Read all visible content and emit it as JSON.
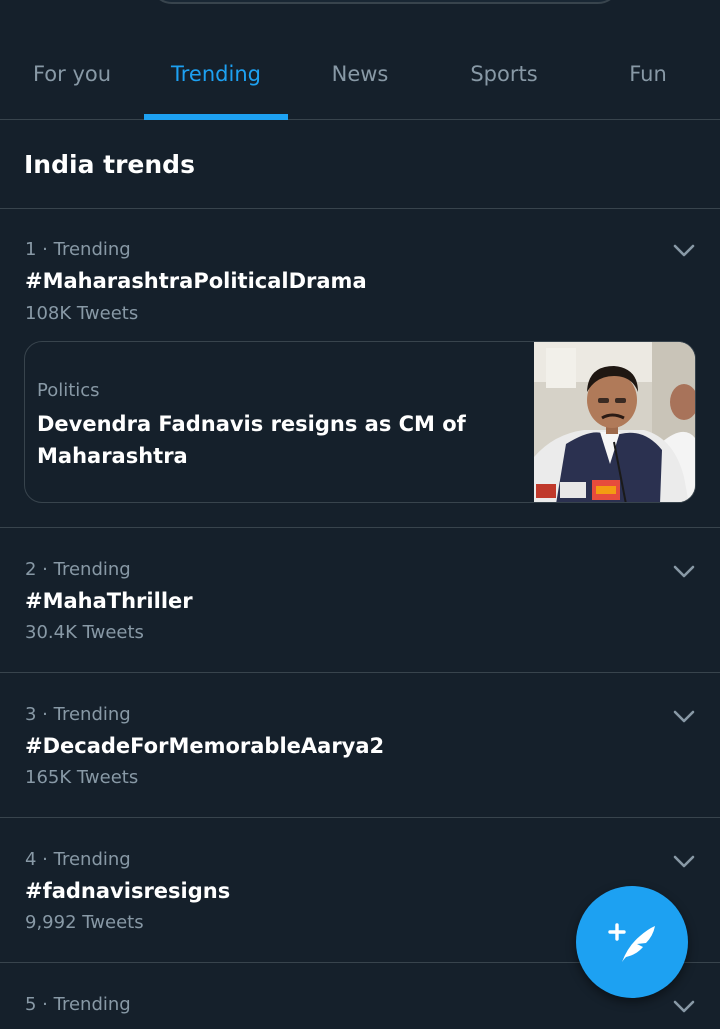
{
  "tabs": [
    {
      "label": "For you",
      "active": false
    },
    {
      "label": "Trending",
      "active": true
    },
    {
      "label": "News",
      "active": false
    },
    {
      "label": "Sports",
      "active": false
    },
    {
      "label": "Fun",
      "active": false
    }
  ],
  "section": {
    "title": "India trends"
  },
  "trends": [
    {
      "meta": "1 · Trending",
      "name": "#MaharashtraPoliticalDrama",
      "count": "108K Tweets"
    },
    {
      "meta": "2 · Trending",
      "name": "#MahaThriller",
      "count": "30.4K Tweets"
    },
    {
      "meta": "3 · Trending",
      "name": "#DecadeForMemorableAarya2",
      "count": "165K Tweets"
    },
    {
      "meta": "4 · Trending",
      "name": "#fadnavisresigns",
      "count": "9,992 Tweets"
    },
    {
      "meta": "5 · Trending"
    }
  ],
  "news_card": {
    "category": "Politics",
    "headline": "Devendra Fadnavis resigns as CM of Maharashtra"
  },
  "icons": {
    "chevron": "chevron-down-icon",
    "compose": "compose-tweet-icon"
  },
  "colors": {
    "background": "#15202b",
    "accent": "#1da1f2",
    "secondary_text": "#8899a6",
    "divider": "#38444d"
  }
}
